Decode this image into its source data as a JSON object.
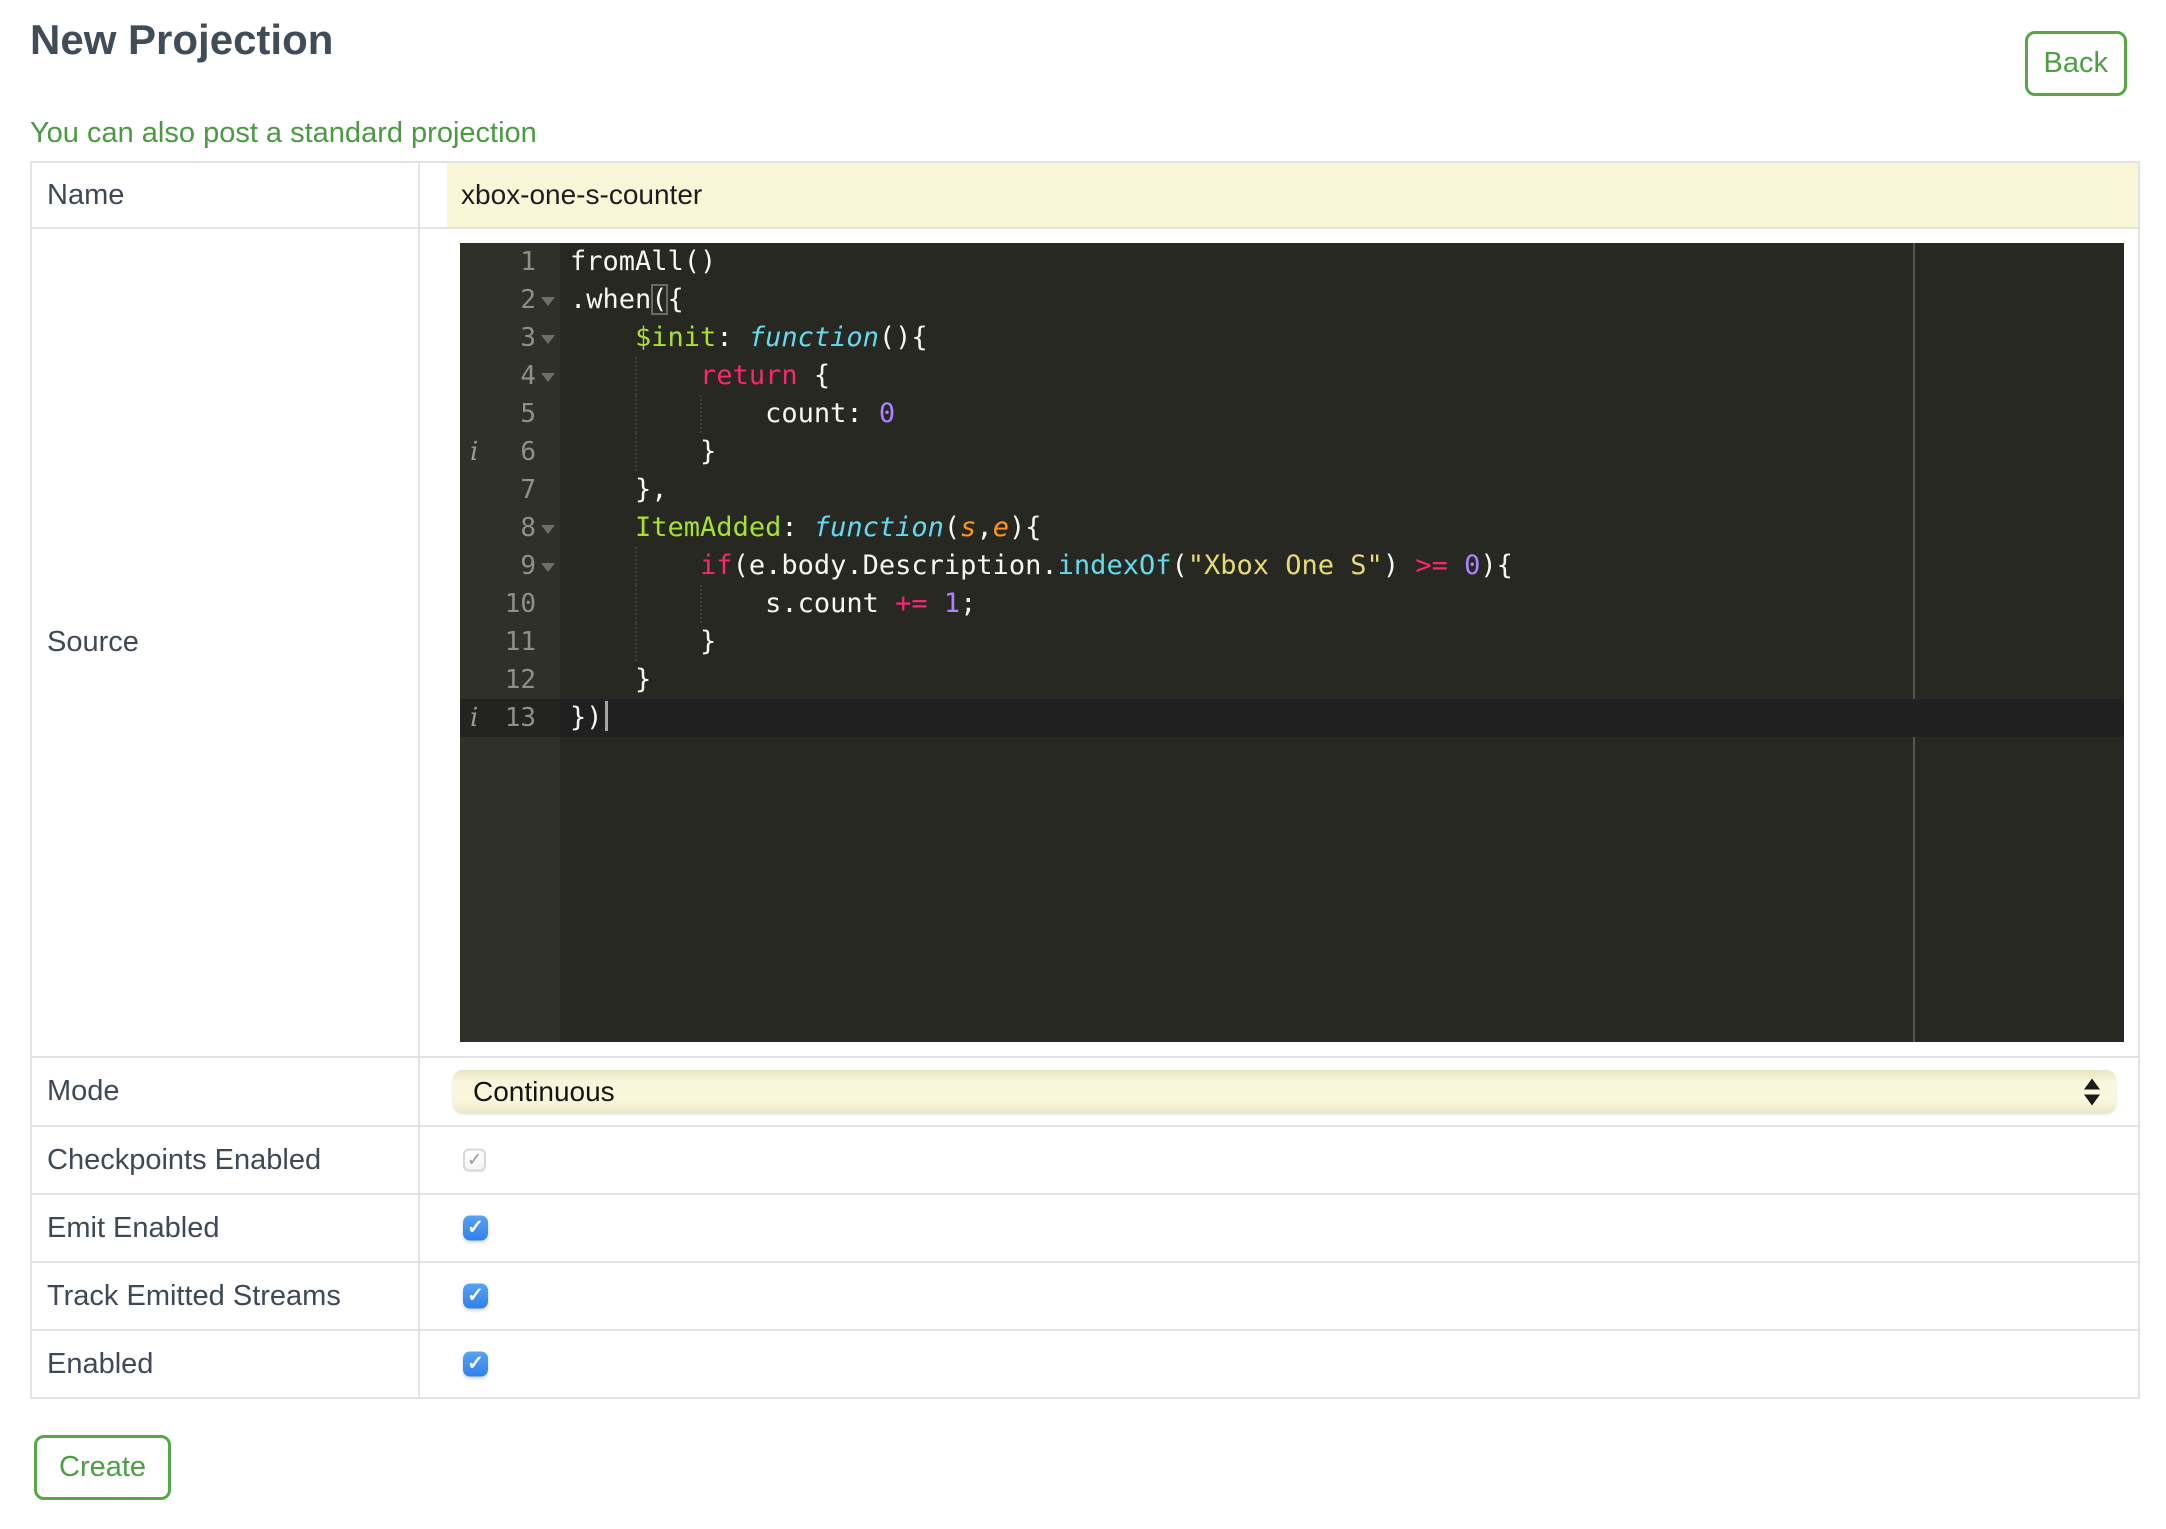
{
  "header": {
    "title": "New Projection",
    "back_label": "Back"
  },
  "link_text": "You can also post a standard projection",
  "form": {
    "name_label": "Name",
    "name_value": "xbox-one-s-counter",
    "source_label": "Source",
    "mode_label": "Mode",
    "mode_value": "Continuous",
    "checkbox_rows": [
      {
        "label": "Checkpoints Enabled",
        "checked": true,
        "disabled": true
      },
      {
        "label": "Emit Enabled",
        "checked": true,
        "disabled": false
      },
      {
        "label": "Track Emitted Streams",
        "checked": true,
        "disabled": false
      },
      {
        "label": "Enabled",
        "checked": true,
        "disabled": false
      }
    ],
    "create_label": "Create"
  },
  "colors": {
    "accent_green": "#4E9E44",
    "field_yellow": "#FAF7D8",
    "checkbox_blue": "#3F8FEF",
    "heading_slate": "#414C59"
  },
  "editor": {
    "language": "javascript",
    "theme": "monokai",
    "token_colors": {
      "plain": "#F8F8F2",
      "keyword": "#F92672",
      "storage_function": "#66D9EF",
      "support_function": "#66D9EF",
      "entity_name": "#A6E22E",
      "parameter": "#FD971F",
      "string": "#E6DB74",
      "number": "#AE81FF",
      "background": "#272822",
      "gutter": "#2F3129",
      "line_number": "#8F908A",
      "active_line": "#202020"
    },
    "lines": [
      {
        "n": 1,
        "tokens": [
          [
            "plain",
            "fromAll()"
          ]
        ]
      },
      {
        "n": 2,
        "fold": true,
        "tokens": [
          [
            "plain",
            ".when"
          ],
          [
            "bracket",
            "("
          ],
          [
            "plain",
            "{"
          ]
        ]
      },
      {
        "n": 3,
        "fold": true,
        "tokens": [
          [
            "plain",
            "    "
          ],
          [
            "entity",
            "$init"
          ],
          [
            "plain",
            ": "
          ],
          [
            "storage",
            "function"
          ],
          [
            "plain",
            "(){"
          ]
        ]
      },
      {
        "n": 4,
        "fold": true,
        "guides": [
          4
        ],
        "tokens": [
          [
            "plain",
            "        "
          ],
          [
            "kw",
            "return"
          ],
          [
            "plain",
            " {"
          ]
        ]
      },
      {
        "n": 5,
        "guides": [
          4,
          8
        ],
        "tokens": [
          [
            "plain",
            "            count: "
          ],
          [
            "num",
            "0"
          ]
        ]
      },
      {
        "n": 6,
        "info": true,
        "guides": [
          4
        ],
        "tokens": [
          [
            "plain",
            "        }"
          ]
        ]
      },
      {
        "n": 7,
        "tokens": [
          [
            "plain",
            "    },"
          ]
        ]
      },
      {
        "n": 8,
        "fold": true,
        "tokens": [
          [
            "plain",
            "    "
          ],
          [
            "entity",
            "ItemAdded"
          ],
          [
            "plain",
            ": "
          ],
          [
            "storage",
            "function"
          ],
          [
            "plain",
            "("
          ],
          [
            "param",
            "s"
          ],
          [
            "plain",
            ","
          ],
          [
            "param",
            "e"
          ],
          [
            "plain",
            "){"
          ]
        ]
      },
      {
        "n": 9,
        "fold": true,
        "guides": [
          4
        ],
        "tokens": [
          [
            "plain",
            "        "
          ],
          [
            "kw",
            "if"
          ],
          [
            "plain",
            "(e.body.Description."
          ],
          [
            "support",
            "indexOf"
          ],
          [
            "plain",
            "("
          ],
          [
            "str",
            "\"Xbox One S\""
          ],
          [
            "plain",
            ") "
          ],
          [
            "kw",
            ">="
          ],
          [
            "plain",
            " "
          ],
          [
            "num",
            "0"
          ],
          [
            "plain",
            "){"
          ]
        ]
      },
      {
        "n": 10,
        "guides": [
          4,
          8
        ],
        "tokens": [
          [
            "plain",
            "            s.count "
          ],
          [
            "kw",
            "+="
          ],
          [
            "plain",
            " "
          ],
          [
            "num",
            "1"
          ],
          [
            "plain",
            ";"
          ]
        ]
      },
      {
        "n": 11,
        "guides": [
          4
        ],
        "tokens": [
          [
            "plain",
            "        }"
          ]
        ]
      },
      {
        "n": 12,
        "tokens": [
          [
            "plain",
            "    }"
          ]
        ]
      },
      {
        "n": 13,
        "info": true,
        "active": true,
        "cursor": true,
        "tokens": [
          [
            "plain",
            "})"
          ]
        ]
      }
    ]
  }
}
